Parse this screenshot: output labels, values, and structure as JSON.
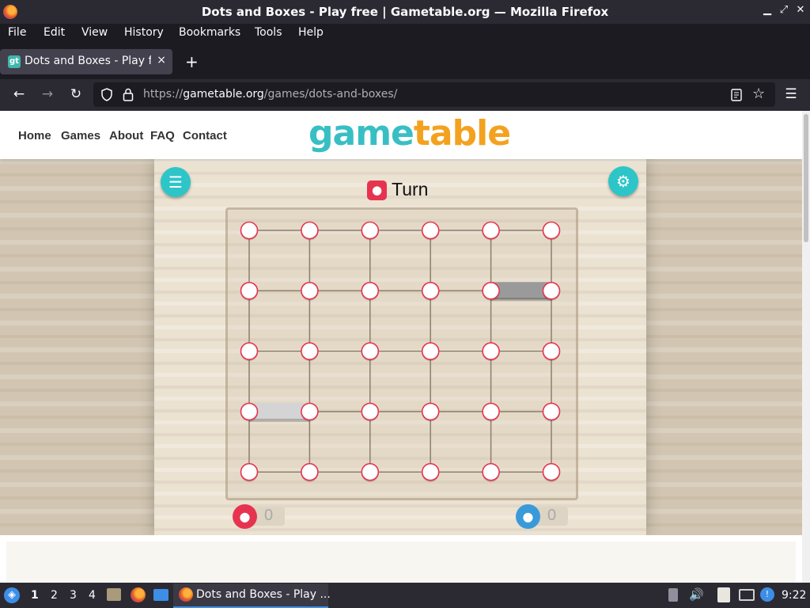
{
  "window": {
    "title": "Dots and Boxes - Play free | Gametable.org — Mozilla Firefox"
  },
  "menu": [
    "File",
    "Edit",
    "View",
    "History",
    "Bookmarks",
    "Tools",
    "Help"
  ],
  "tab": {
    "title": "Dots and Boxes - Play free | Gametable.org",
    "close": "×",
    "new_tab": "+"
  },
  "address": {
    "prefix": "https://",
    "domain": "gametable.org",
    "path": "/games/dots-and-boxes/"
  },
  "site": {
    "nav": [
      "Home",
      "Games",
      "About",
      "FAQ",
      "Contact"
    ],
    "logo": {
      "part1": "game",
      "part2": "table"
    }
  },
  "game": {
    "turn_label": "Turn",
    "turn_player_color": "#e63450",
    "grid": {
      "cols": 6,
      "rows": 5
    },
    "placed_lines": [
      {
        "type": "h",
        "row": 1,
        "col": 4,
        "shade": "dark"
      },
      {
        "type": "h",
        "row": 3,
        "col": 0,
        "shade": "light"
      }
    ],
    "scores": [
      {
        "player": "red",
        "value": "0",
        "color": "#e63450"
      },
      {
        "player": "blue",
        "value": "0",
        "color": "#3a9ad9"
      }
    ]
  },
  "taskbar": {
    "workspaces": [
      "1",
      "2",
      "3",
      "4"
    ],
    "task_label": "Dots and Boxes - Play ...",
    "clock": "9:22"
  }
}
